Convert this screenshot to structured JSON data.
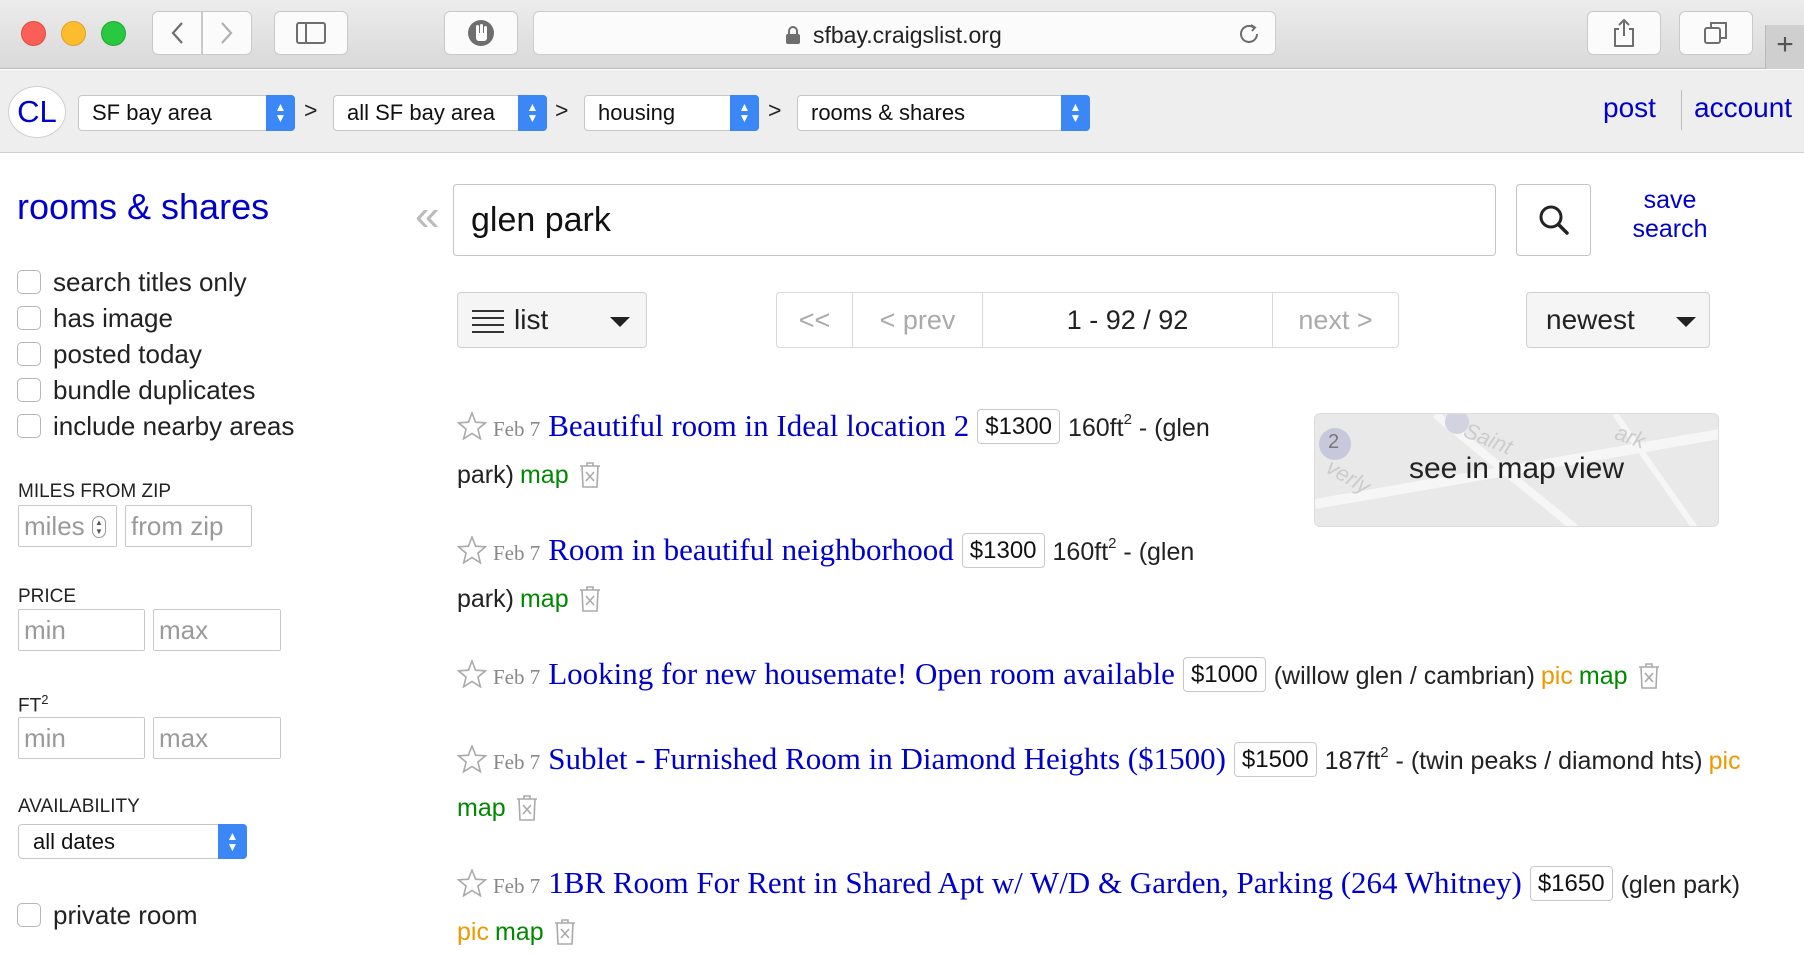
{
  "browser": {
    "url": "sfbay.craigslist.org"
  },
  "breadcrumbs": {
    "logo": "CL",
    "site": "SF bay area",
    "area": "all SF bay area",
    "category": "housing",
    "subcategory": "rooms & shares",
    "separator": ">",
    "post": "post",
    "account": "account"
  },
  "sidebar": {
    "title": "rooms & shares",
    "checkboxes": [
      "search titles only",
      "has image",
      "posted today",
      "bundle duplicates",
      "include nearby areas"
    ],
    "miles_label": "MILES FROM ZIP",
    "miles_placeholder": "miles",
    "zip_placeholder": "from zip",
    "price_label": "PRICE",
    "price_min": "min",
    "price_max": "max",
    "ft_label": "FT",
    "ft_sup": "2",
    "ft_min": "min",
    "ft_max": "max",
    "availability_label": "AVAILABILITY",
    "availability_value": "all dates",
    "private_room": "private room"
  },
  "search": {
    "query": "glen park",
    "save_line1": "save",
    "save_line2": "search"
  },
  "toolbar": {
    "view": "list",
    "first": "<<",
    "prev": "< prev",
    "range": "1 - 92 / 92",
    "next": "next >",
    "sort": "newest"
  },
  "map_preview": {
    "label": "see in map view",
    "badge": "2"
  },
  "listings": [
    {
      "date": "Feb 7",
      "title": "Beautiful room in Ideal location 2",
      "price": "$1300",
      "size": "160ft",
      "size_sup": "2",
      "location_a": " - (glen",
      "location_b": "park)",
      "pic": "",
      "map": "map"
    },
    {
      "date": "Feb 7",
      "title": "Room in beautiful neighborhood",
      "price": "$1300",
      "size": "160ft",
      "size_sup": "2",
      "location_a": " - (glen",
      "location_b": "park)",
      "pic": "",
      "map": "map"
    },
    {
      "date": "Feb 7",
      "title": "Looking for new housemate! Open room available",
      "price": "$1000",
      "location": "(willow glen / cambrian)",
      "pic": "pic",
      "map": "map"
    },
    {
      "date": "Feb 7",
      "title": "Sublet - Furnished Room in Diamond Heights ($1500)",
      "price": "$1500",
      "size": "187ft",
      "size_sup": "2",
      "location_a": " - (twin peaks / diamond hts)",
      "pic": "pic",
      "map": "map"
    },
    {
      "date": "Feb 7",
      "title": "1BR Room For Rent in Shared Apt w/ W/D & Garden, Parking (264 Whitney)",
      "price": "$1650",
      "location": "(glen park)",
      "pic": "pic",
      "map": "map"
    }
  ]
}
